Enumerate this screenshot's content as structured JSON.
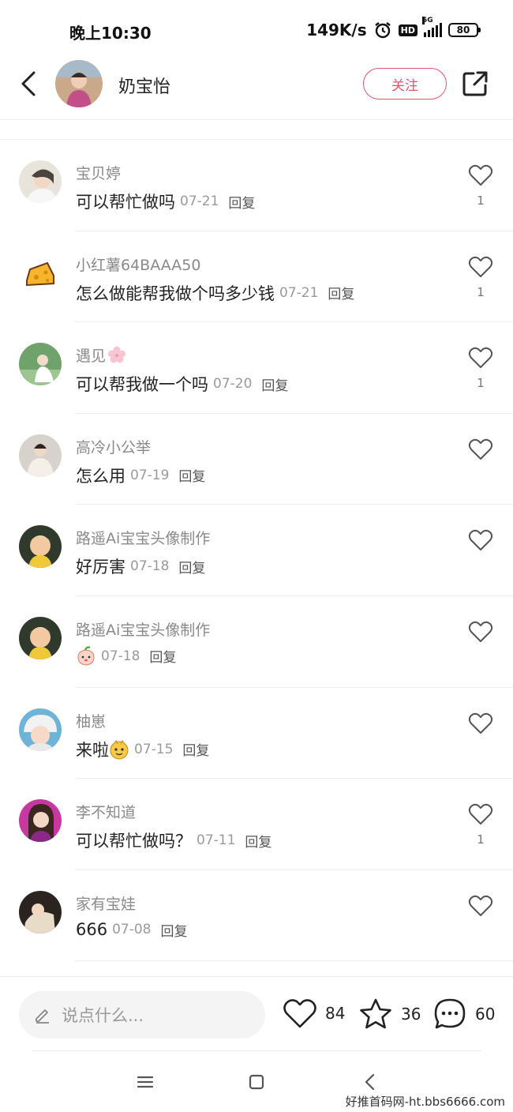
{
  "status_bar": {
    "time": "晚上10:30",
    "speed": "149K/s",
    "hd": "HD",
    "network": "5G",
    "battery": "80"
  },
  "header": {
    "name": "奶宝怡",
    "follow_label": "关注"
  },
  "comments": [
    {
      "username": "宝贝婷",
      "text": "可以帮忙做吗",
      "date": "07-21",
      "reply": "回复",
      "likes": "1"
    },
    {
      "username": "小红薯64BAAA50",
      "text": "怎么做能帮我做个吗多少钱",
      "date": "07-21",
      "reply": "回复",
      "likes": "1"
    },
    {
      "username": "遇见",
      "text": "可以帮我做一个吗",
      "date": "07-20",
      "reply": "回复",
      "likes": "1"
    },
    {
      "username": "高冷小公举",
      "text": "怎么用",
      "date": "07-19",
      "reply": "回复",
      "likes": ""
    },
    {
      "username": "路遥Ai宝宝头像制作",
      "text": "好厉害",
      "date": "07-18",
      "reply": "回复",
      "likes": ""
    },
    {
      "username": "路遥Ai宝宝头像制作",
      "text": "",
      "date": "07-18",
      "reply": "回复",
      "likes": ""
    },
    {
      "username": "柚崽",
      "text": "来啦",
      "date": "07-15",
      "reply": "回复",
      "likes": ""
    },
    {
      "username": "李不知道",
      "text": "可以帮忙做吗？",
      "date": "07-11",
      "reply": "回复",
      "likes": "1"
    },
    {
      "username": "家有宝娃",
      "text": "666",
      "date": "07-08",
      "reply": "回复",
      "likes": ""
    }
  ],
  "bottom_bar": {
    "input_placeholder": "说点什么...",
    "like_count": "84",
    "star_count": "36",
    "comment_count": "60"
  },
  "watermark": "好推首码网-ht.bbs6666.com",
  "colors": {
    "accent": "#e0566f",
    "meta_text": "#9a9a9a",
    "divider": "#eeeeee"
  }
}
